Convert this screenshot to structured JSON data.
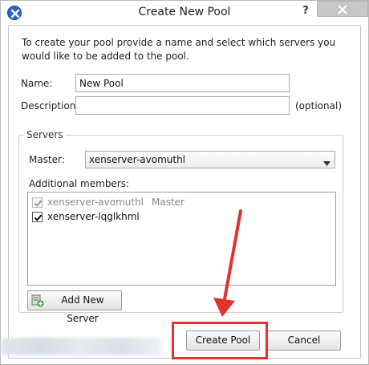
{
  "window": {
    "title": "Create New Pool",
    "help_label": "?",
    "close_icon": "close-icon",
    "app_icon": "xencenter-logo-icon"
  },
  "intro_text": "To create your pool provide a name and select which servers you would like to be added to the pool.",
  "form": {
    "name_label": "Name:",
    "name_value": "New Pool",
    "description_label": "Description:",
    "description_value": "",
    "optional_label": "(optional)"
  },
  "servers": {
    "group_title": "Servers",
    "master_label": "Master:",
    "master_value": "xenserver-avomuthl",
    "additional_label": "Additional members:",
    "members": [
      {
        "name": "xenserver-avomuthl",
        "role": "Master",
        "checked": true,
        "disabled": true
      },
      {
        "name": "xenserver-lqglkhml",
        "role": "",
        "checked": true,
        "disabled": false
      }
    ],
    "add_server_label": "Add New Server"
  },
  "buttons": {
    "create_label": "Create Pool",
    "cancel_label": "Cancel"
  },
  "colors": {
    "annotation_red": "#e0322f",
    "accent_blue": "#2a66c8"
  }
}
